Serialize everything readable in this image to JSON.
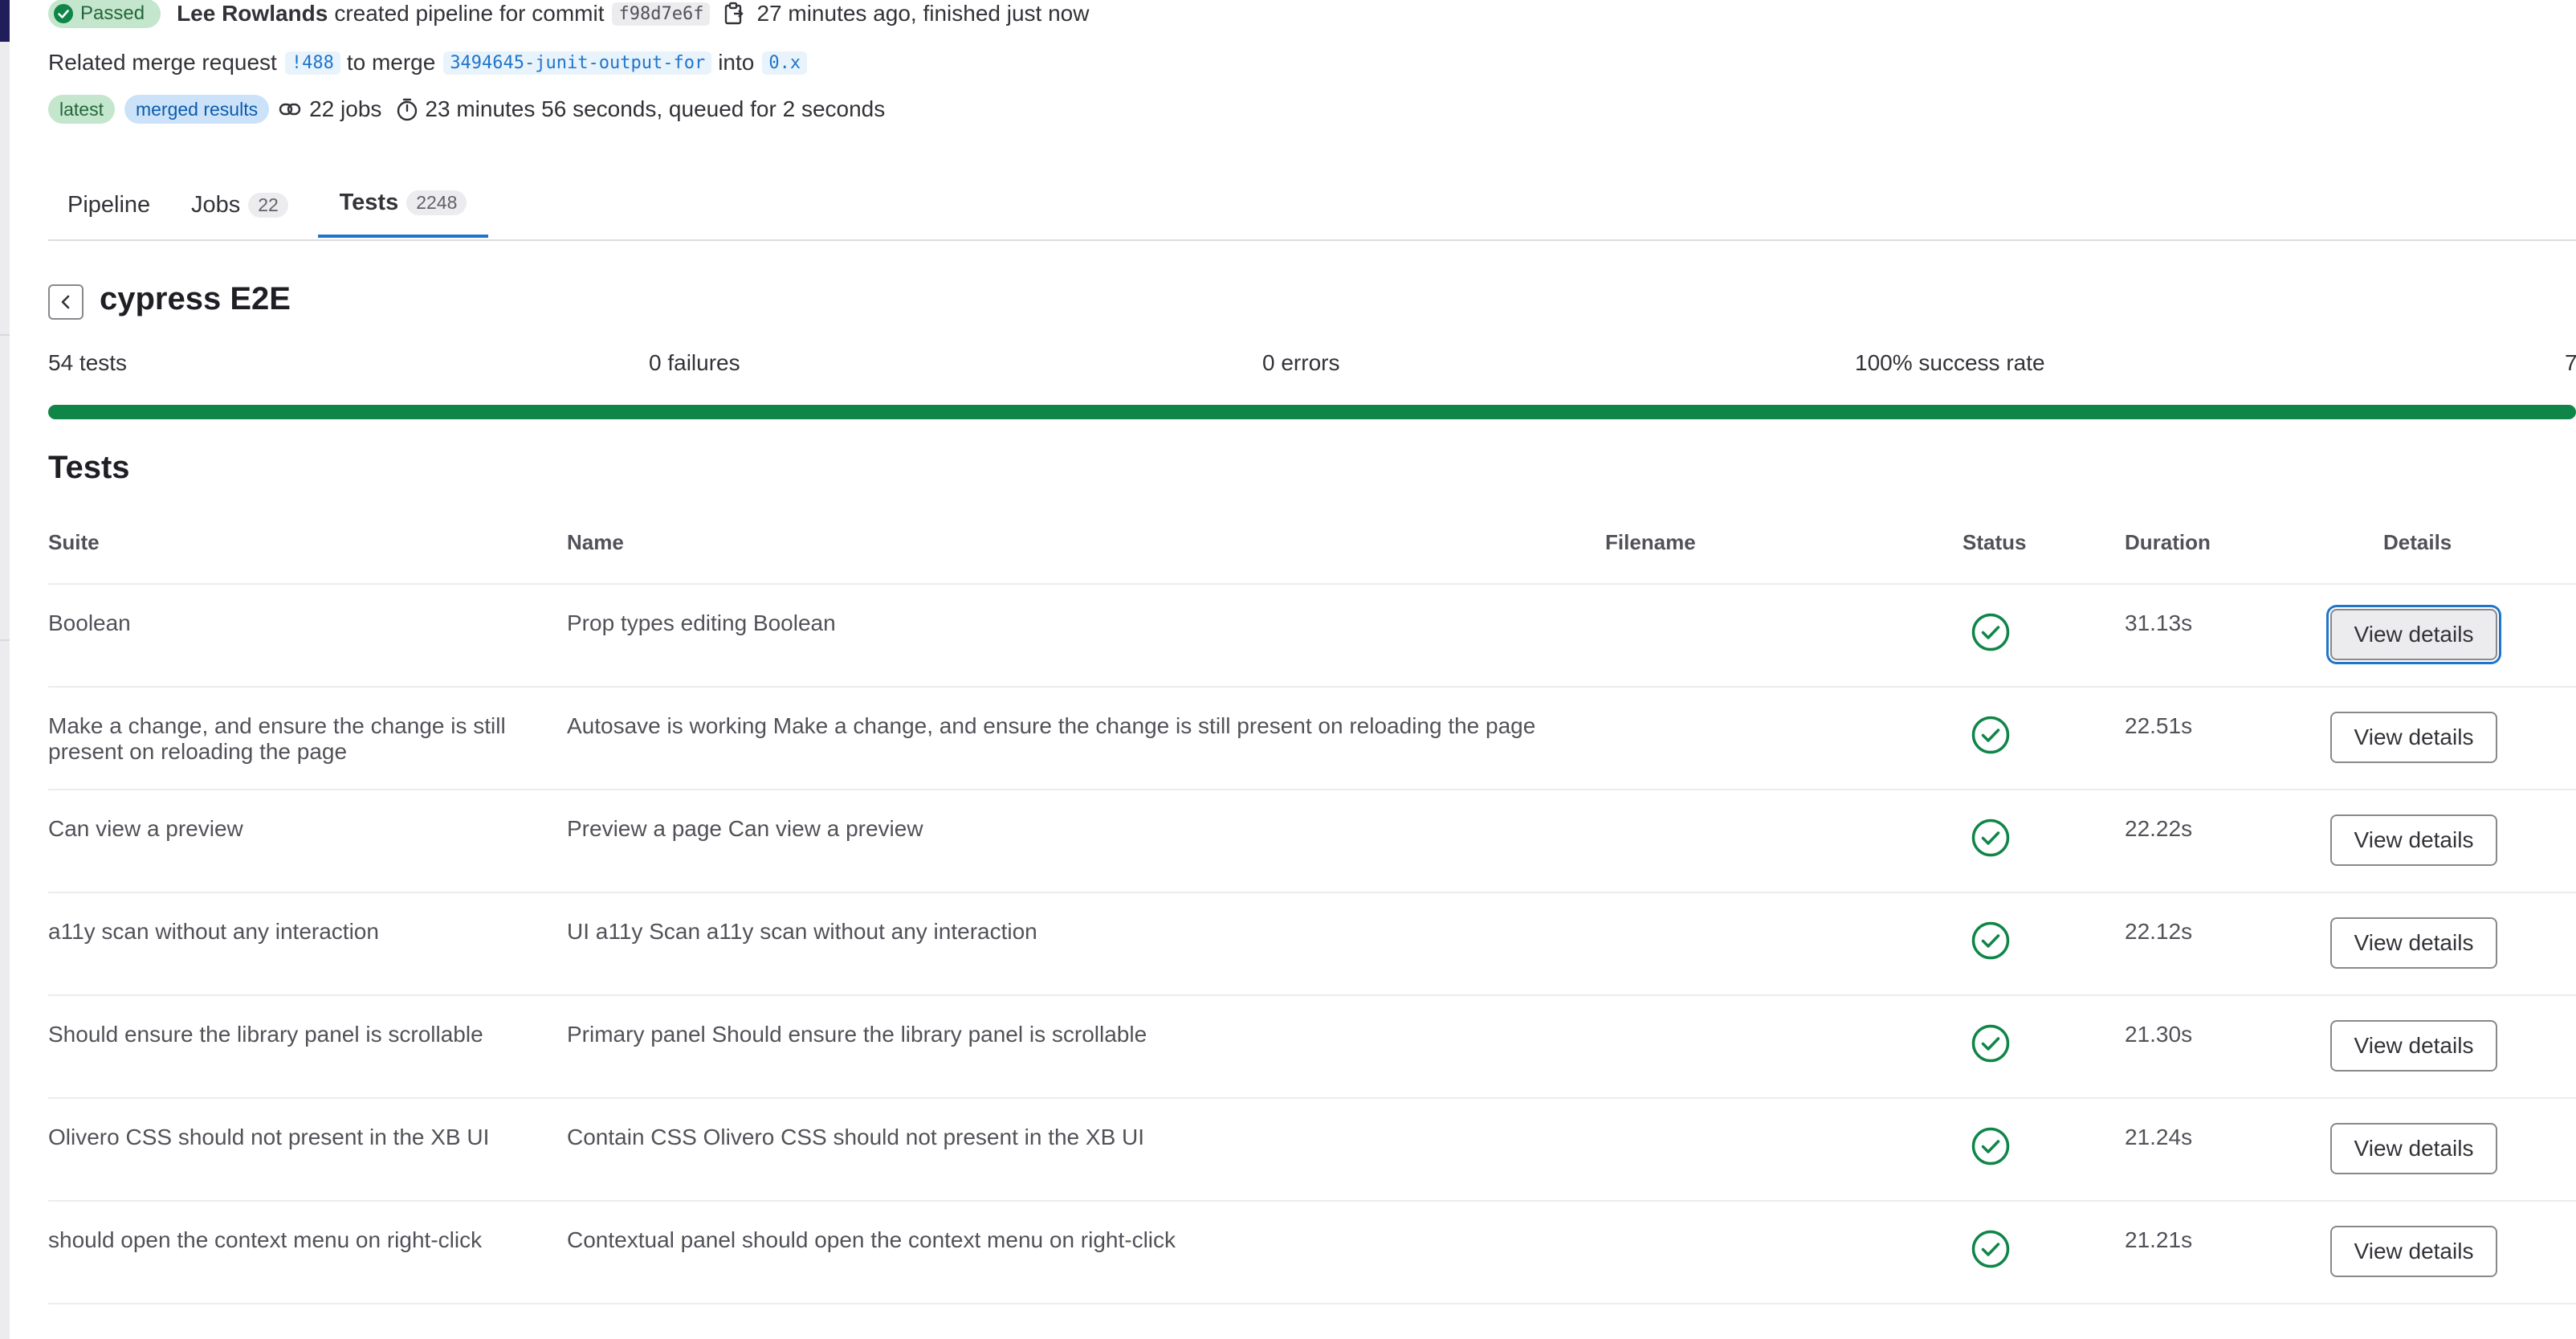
{
  "header": {
    "status_label": "Passed",
    "author": "Lee Rowlands",
    "action_text": "created pipeline for commit",
    "commit_sha": "f98d7e6f",
    "time_text": "27 minutes ago, finished just now",
    "mr_prefix": "Related merge request",
    "mr_id": "!488",
    "mr_to_merge": "to merge",
    "source_branch": "3494645-junit-output-for",
    "into_text": "into",
    "target_branch": "0.x",
    "badges": [
      "latest",
      "merged results"
    ],
    "jobs_text": "22 jobs",
    "duration_text": "23 minutes 56 seconds, queued for 2 seconds"
  },
  "tabs": [
    {
      "label": "Pipeline",
      "count": ""
    },
    {
      "label": "Jobs",
      "count": "22"
    },
    {
      "label": "Tests",
      "count": "2248"
    }
  ],
  "suite": {
    "title": "cypress E2E",
    "tests": "54 tests",
    "failures": "0 failures",
    "errors": "0 errors",
    "success_rate": "100% success rate",
    "truncated_stat": "7",
    "progress_success": 1.0
  },
  "tests_section": {
    "heading": "Tests",
    "columns": [
      "Suite",
      "Name",
      "Filename",
      "Status",
      "Duration",
      "Details"
    ],
    "rows": [
      {
        "suite": "Boolean",
        "name": "Prop types editing Boolean",
        "filename": "",
        "status": "success",
        "duration": "31.13s",
        "action": "View details"
      },
      {
        "suite": "Make a change, and ensure the change is still present on reloading the page",
        "name": "Autosave is working Make a change, and ensure the change is still present on reloading the page",
        "filename": "",
        "status": "success",
        "duration": "22.51s",
        "action": "View details"
      },
      {
        "suite": "Can view a preview",
        "name": "Preview a page Can view a preview",
        "filename": "",
        "status": "success",
        "duration": "22.22s",
        "action": "View details"
      },
      {
        "suite": "a11y scan without any interaction",
        "name": "UI a11y Scan a11y scan without any interaction",
        "filename": "",
        "status": "success",
        "duration": "22.12s",
        "action": "View details"
      },
      {
        "suite": "Should ensure the library panel is scrollable",
        "name": "Primary panel Should ensure the library panel is scrollable",
        "filename": "",
        "status": "success",
        "duration": "21.30s",
        "action": "View details"
      },
      {
        "suite": "Olivero CSS should not present in the XB UI",
        "name": "Contain CSS Olivero CSS should not present in the XB UI",
        "filename": "",
        "status": "success",
        "duration": "21.24s",
        "action": "View details"
      },
      {
        "suite": "should open the context menu on right-click",
        "name": "Contextual panel should open the context menu on right-click",
        "filename": "",
        "status": "success",
        "duration": "21.21s",
        "action": "View details"
      }
    ]
  },
  "colors": {
    "success": "#108548",
    "link": "#1f75cb",
    "nav_active": "#1f1e5a"
  },
  "icons": [
    "check-circle-icon",
    "clipboard-icon",
    "link-icon",
    "timer-icon",
    "chevron-left-icon"
  ]
}
